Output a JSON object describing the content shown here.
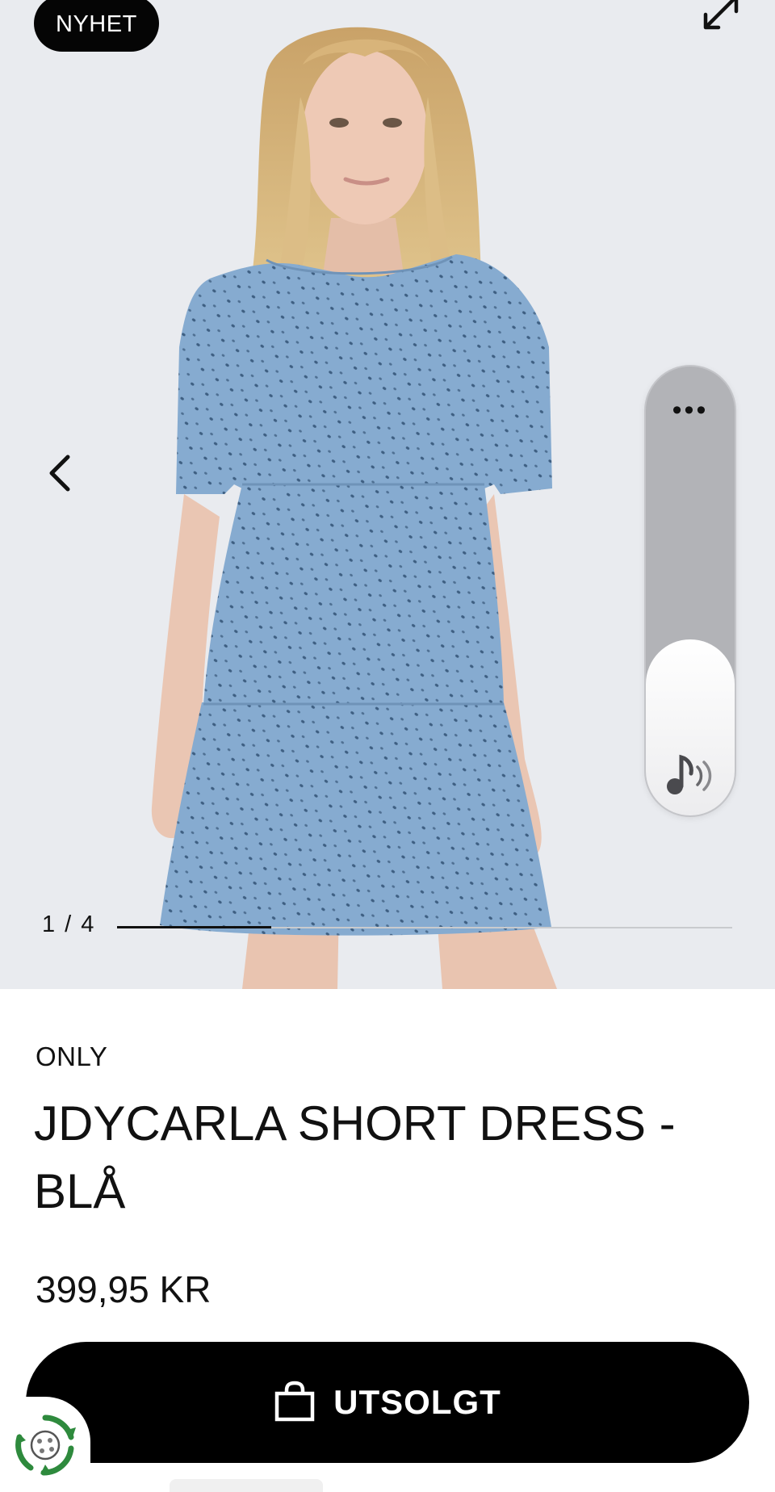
{
  "gallery": {
    "badge": "NYHET",
    "counter": "1 / 4",
    "progress": 0.25,
    "overlay": {
      "dots": "•••"
    }
  },
  "product": {
    "brand": "ONLY",
    "title": "JDYCARLA SHORT DRESS - BLÅ",
    "price": "399,95 KR"
  },
  "buy_button": {
    "label": "UTSOLGT"
  },
  "colors": {
    "gallery_bg": "#e9ebef",
    "dress": "#86abd0",
    "button": "#000000",
    "eco_green": "#2e8a3d"
  },
  "icons": [
    "expand-icon",
    "chevron-left-icon",
    "more-dots-icon",
    "music-sound-icon",
    "shopping-bag-icon",
    "recycle-eco-icon"
  ]
}
